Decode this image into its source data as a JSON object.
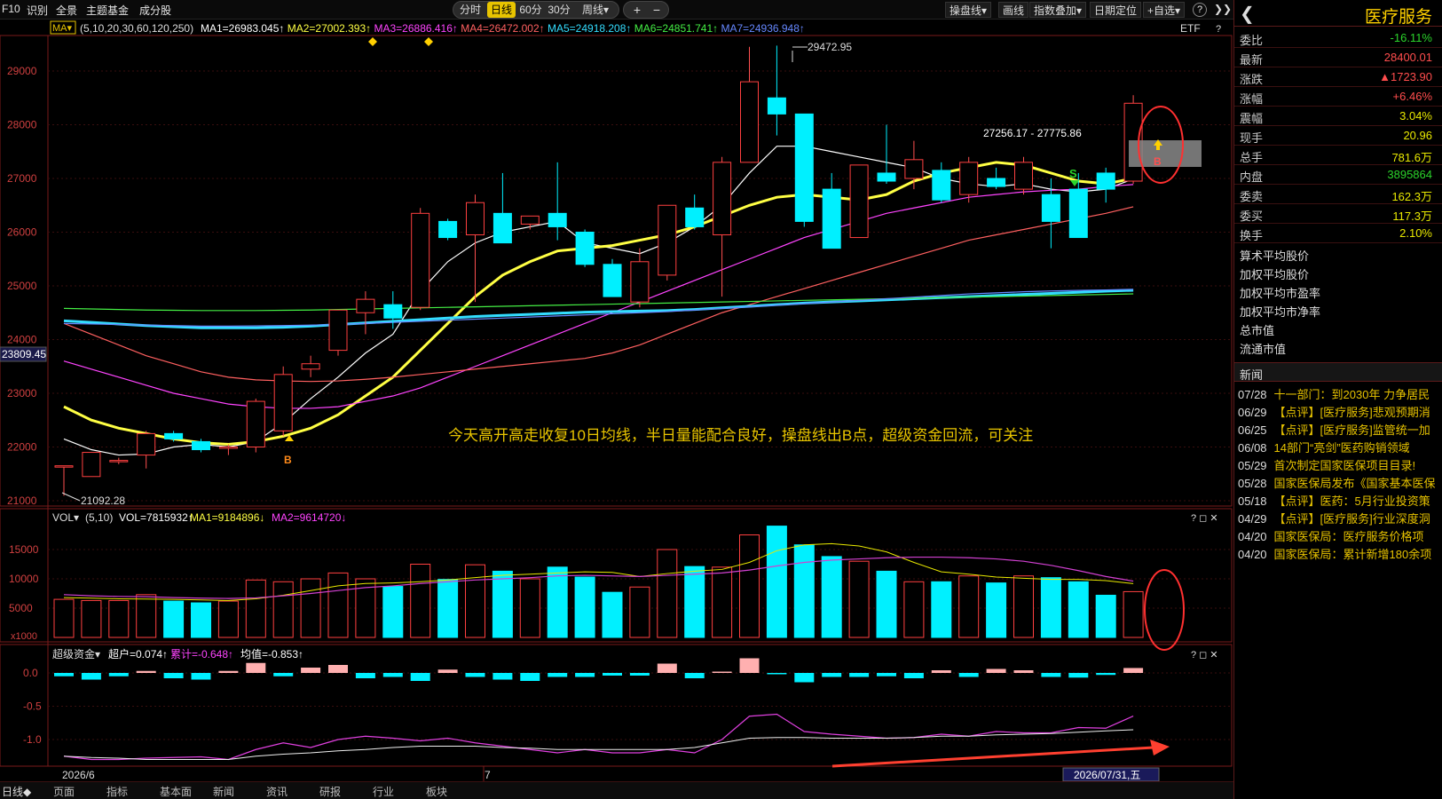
{
  "toolbar": {
    "items": [
      "F10",
      "识别",
      "全景",
      "主题基金",
      "成分股"
    ],
    "period_tabs": [
      "分时",
      "日线",
      "60分",
      "30分",
      "周线▾"
    ],
    "active_tab": "日线",
    "zoom_in": "+",
    "zoom_out": "−",
    "right_buttons": [
      "操盘线▾",
      "画线",
      "指数叠加▾",
      "日期定位",
      "+自选▾"
    ],
    "help": "?",
    "collapse": "❯❯"
  },
  "ma_line": {
    "selector": "MA▾",
    "params": "(5,10,20,30,60,120,250)",
    "entries": [
      {
        "text": "MA1=26983.045↑",
        "color": "#ffffff"
      },
      {
        "text": "MA2=27002.393↑",
        "color": "#ffff44"
      },
      {
        "text": "MA3=26886.416↑",
        "color": "#ff44ff"
      },
      {
        "text": "MA4=26472.002↑",
        "color": "#ff6060"
      },
      {
        "text": "MA5=24918.208↑",
        "color": "#33ddff"
      },
      {
        "text": "MA6=24851.741↑",
        "color": "#44ee44"
      },
      {
        "text": "MA7=24936.948↑",
        "color": "#6688ff"
      }
    ],
    "etf_label": "ETF",
    "help": "?"
  },
  "main_chart": {
    "y_ticks": [
      "29000",
      "28000",
      "27000",
      "26000",
      "25000",
      "24000",
      "23000",
      "22000",
      "21000"
    ],
    "current_label": "23809.45",
    "high_label": "29472.95",
    "low_label": "21092.28",
    "range_label": "27256.17 - 27775.86",
    "annotation": "今天高开高走收复10日均线，半日量能配合良好，操盘线出B点，超级资金回流，可关注",
    "signal_b": "B",
    "signal_s": "S"
  },
  "chart_data": {
    "type": "candlestick",
    "candles": [
      [
        21650,
        21650,
        21092,
        21650
      ],
      [
        21450,
        21900,
        21450,
        21900
      ],
      [
        21730,
        21800,
        21680,
        21750
      ],
      [
        21850,
        22300,
        21600,
        22250
      ],
      [
        22250,
        22300,
        22100,
        22150
      ],
      [
        22100,
        22150,
        21900,
        21950
      ],
      [
        22000,
        22050,
        21850,
        22000
      ],
      [
        22000,
        22900,
        21900,
        22850
      ],
      [
        22300,
        23500,
        22200,
        23350
      ],
      [
        23450,
        23700,
        23300,
        23550
      ],
      [
        23800,
        24200,
        23700,
        24550
      ],
      [
        24500,
        24900,
        24100,
        24750
      ],
      [
        24650,
        24900,
        24200,
        24400
      ],
      [
        24600,
        26450,
        24550,
        26350
      ],
      [
        26200,
        26250,
        25850,
        25900
      ],
      [
        25950,
        26700,
        24700,
        26550
      ],
      [
        26350,
        27100,
        25950,
        25800
      ],
      [
        26150,
        26300,
        26050,
        26300
      ],
      [
        26350,
        27300,
        25850,
        26100
      ],
      [
        26000,
        26050,
        25350,
        25400
      ],
      [
        25400,
        25500,
        24800,
        24800
      ],
      [
        24700,
        25700,
        24600,
        25450
      ],
      [
        25200,
        26500,
        25100,
        26500
      ],
      [
        26450,
        26700,
        26050,
        26100
      ],
      [
        25950,
        27400,
        24800,
        27300
      ],
      [
        27300,
        29450,
        27350,
        28800
      ],
      [
        28500,
        29472.95,
        27800,
        28200
      ],
      [
        28200,
        28200,
        26100,
        26200
      ],
      [
        26800,
        27100,
        25900,
        25700
      ],
      [
        25900,
        27200,
        25900,
        27250
      ],
      [
        27100,
        28000,
        26900,
        26950
      ],
      [
        27000,
        27700,
        26800,
        27350
      ],
      [
        27150,
        27300,
        26550,
        26600
      ],
      [
        26700,
        27400,
        26550,
        27300
      ],
      [
        27000,
        27200,
        26800,
        26850
      ],
      [
        26800,
        27400,
        26700,
        27300
      ],
      [
        26700,
        27000,
        25700,
        26200
      ],
      [
        26800,
        27100,
        25900,
        25900
      ],
      [
        27100,
        27200,
        26550,
        26800
      ],
      [
        26950,
        28550,
        26900,
        28400
      ]
    ],
    "ma_series": [
      {
        "name": "MA1",
        "color": "#ffffff",
        "values": [
          22150,
          21950,
          21850,
          21870,
          22000,
          22050,
          22000,
          22100,
          22450,
          22900,
          23300,
          23750,
          24100,
          24900,
          25450,
          25800,
          26000,
          26100,
          26200,
          25800,
          25700,
          25600,
          25800,
          26100,
          26500,
          27100,
          27600,
          27600,
          27500,
          27400,
          27300,
          27200,
          27000,
          26900,
          26850,
          26900,
          26800,
          26750,
          26800,
          26990
        ]
      },
      {
        "name": "MA2",
        "color": "#ffff44",
        "values": [
          22750,
          22500,
          22350,
          22250,
          22150,
          22080,
          22050,
          22100,
          22200,
          22350,
          22600,
          22950,
          23300,
          23800,
          24300,
          24800,
          25200,
          25450,
          25650,
          25700,
          25750,
          25850,
          25950,
          26100,
          26300,
          26500,
          26650,
          26700,
          26650,
          26600,
          26700,
          26950,
          27100,
          27200,
          27300,
          27250,
          27100,
          26950,
          26900,
          27002
        ]
      },
      {
        "name": "MA3",
        "color": "#ff44ff",
        "values": [
          23600,
          23450,
          23300,
          23150,
          23000,
          22900,
          22800,
          22750,
          22720,
          22720,
          22750,
          22850,
          22950,
          23100,
          23300,
          23500,
          23700,
          23900,
          24100,
          24300,
          24500,
          24700,
          24900,
          25100,
          25300,
          25500,
          25700,
          25900,
          26050,
          26200,
          26350,
          26450,
          26550,
          26650,
          26700,
          26750,
          26780,
          26800,
          26850,
          26886
        ]
      },
      {
        "name": "MA4",
        "color": "#ff6060",
        "values": [
          24300,
          24100,
          23900,
          23700,
          23550,
          23400,
          23300,
          23250,
          23230,
          23220,
          23230,
          23260,
          23300,
          23350,
          23400,
          23450,
          23500,
          23550,
          23600,
          23650,
          23750,
          23900,
          24100,
          24300,
          24500,
          24650,
          24800,
          24950,
          25100,
          25250,
          25400,
          25550,
          25700,
          25850,
          25950,
          26050,
          26150,
          26250,
          26350,
          26472
        ]
      },
      {
        "name": "MA5",
        "color": "#33ddff",
        "values": [
          24350,
          24320,
          24290,
          24260,
          24240,
          24220,
          24220,
          24220,
          24230,
          24250,
          24280,
          24310,
          24340,
          24370,
          24400,
          24430,
          24450,
          24470,
          24490,
          24510,
          24520,
          24530,
          24540,
          24560,
          24590,
          24620,
          24650,
          24680,
          24700,
          24720,
          24740,
          24760,
          24780,
          24800,
          24820,
          24840,
          24860,
          24880,
          24900,
          24918
        ]
      },
      {
        "name": "MA6",
        "color": "#44ee44",
        "values": [
          24580,
          24570,
          24560,
          24550,
          24545,
          24540,
          24540,
          24540,
          24545,
          24550,
          24560,
          24570,
          24580,
          24590,
          24600,
          24610,
          24620,
          24630,
          24640,
          24650,
          24660,
          24670,
          24680,
          24690,
          24700,
          24710,
          24720,
          24730,
          24740,
          24750,
          24760,
          24770,
          24780,
          24790,
          24800,
          24810,
          24820,
          24830,
          24840,
          24851
        ]
      },
      {
        "name": "MA7",
        "color": "#6688ff",
        "values": [
          24300,
          24290,
          24280,
          24270,
          24260,
          24250,
          24250,
          24255,
          24260,
          24270,
          24280,
          24300,
          24320,
          24340,
          24360,
          24380,
          24400,
          24420,
          24440,
          24460,
          24480,
          24500,
          24520,
          24550,
          24580,
          24610,
          24640,
          24670,
          24700,
          24730,
          24760,
          24790,
          24820,
          24850,
          24870,
          24890,
          24905,
          24915,
          24925,
          24936
        ]
      }
    ],
    "volume": [
      6500,
      6300,
      6300,
      7300,
      6200,
      5900,
      6200,
      9800,
      9500,
      10000,
      11000,
      10000,
      8700,
      12500,
      9900,
      12400,
      11300,
      10000,
      12000,
      10300,
      7700,
      8600,
      15000,
      12100,
      12000,
      17500,
      19000,
      15800,
      13800,
      13000,
      11300,
      9500,
      9500,
      10500,
      9300,
      10500,
      10200,
      9500,
      7200,
      7815
    ],
    "vol_ma1": [
      6800,
      6700,
      6600,
      6550,
      6500,
      6400,
      6300,
      6600,
      7200,
      8000,
      8800,
      9200,
      9300,
      9500,
      9800,
      10200,
      10600,
      10800,
      11000,
      11200,
      11100,
      10400,
      10900,
      11300,
      11600,
      12800,
      14800,
      15800,
      16000,
      15600,
      14600,
      12800,
      11200,
      10800,
      10300,
      10100,
      9900,
      9900,
      9700,
      9185
    ],
    "vol_ma2": [
      7300,
      7100,
      7000,
      6950,
      6800,
      6700,
      6650,
      6750,
      7100,
      7500,
      8000,
      8500,
      8800,
      9200,
      9500,
      9800,
      10000,
      10200,
      10500,
      10600,
      10500,
      10400,
      10600,
      10800,
      11000,
      11500,
      12200,
      12800,
      13200,
      13400,
      13600,
      13700,
      13700,
      13600,
      13400,
      13000,
      12300,
      11400,
      10400,
      9615
    ],
    "cap_bars": [
      -0.05,
      -0.1,
      -0.05,
      0.03,
      -0.08,
      -0.1,
      0.03,
      0.15,
      -0.05,
      0.08,
      0.12,
      -0.08,
      -0.06,
      -0.12,
      0.05,
      -0.06,
      -0.1,
      -0.12,
      -0.06,
      -0.06,
      -0.04,
      -0.04,
      0.14,
      -0.08,
      0.02,
      0.22,
      -0.02,
      -0.14,
      -0.06,
      -0.06,
      -0.05,
      -0.08,
      0.04,
      -0.06,
      0.06,
      0.04,
      -0.06,
      -0.07,
      -0.03,
      0.074
    ],
    "cap_cum": [
      -1.25,
      -1.3,
      -1.3,
      -1.28,
      -1.27,
      -1.26,
      -1.3,
      -1.15,
      -1.05,
      -1.12,
      -1.0,
      -0.95,
      -0.98,
      -1.02,
      -0.98,
      -1.05,
      -1.1,
      -1.15,
      -1.2,
      -1.15,
      -1.2,
      -1.2,
      -1.15,
      -1.2,
      -1.0,
      -0.65,
      -0.62,
      -0.88,
      -0.92,
      -0.95,
      -0.98,
      -0.97,
      -0.92,
      -0.95,
      -0.88,
      -0.9,
      -0.9,
      -0.82,
      -0.83,
      -0.648
    ],
    "cap_avg": [
      -1.25,
      -1.27,
      -1.28,
      -1.3,
      -1.3,
      -1.3,
      -1.3,
      -1.25,
      -1.22,
      -1.2,
      -1.17,
      -1.15,
      -1.12,
      -1.1,
      -1.1,
      -1.1,
      -1.12,
      -1.13,
      -1.15,
      -1.15,
      -1.15,
      -1.15,
      -1.15,
      -1.12,
      -1.05,
      -0.98,
      -0.97,
      -0.97,
      -0.98,
      -0.98,
      -0.98,
      -0.97,
      -0.95,
      -0.95,
      -0.93,
      -0.92,
      -0.91,
      -0.89,
      -0.87,
      -0.853
    ]
  },
  "vol_panel": {
    "header": "VOL▾",
    "params": "(5,10)",
    "vol": "VOL=7815932↑",
    "ma1": "MA1=9184896↓",
    "ma2": "MA2=9614720↓",
    "y_ticks": [
      "15000",
      "10000",
      "5000"
    ],
    "unit": "x1000"
  },
  "cap_panel": {
    "header": "超级资金▾",
    "chao": "超户=0.074↑",
    "leiji": "累计=-0.648↑",
    "junzhi": "均值=-0.853↑",
    "y_ticks": [
      "0.0",
      "-0.5",
      "-1.0"
    ]
  },
  "x_axis": {
    "left": "2026/6",
    "mid": "7",
    "current": "2026/07/31,五",
    "period": "日线◆"
  },
  "panel_controls": "? ◻ ✕",
  "right_panel": {
    "title": "医疗服务",
    "back": "❮",
    "quote": [
      {
        "label": "委比",
        "value": "-16.11%",
        "color": "#2bd42b"
      },
      {
        "label": "最新",
        "value": "28400.01",
        "color": "#ff4d4d"
      },
      {
        "label": "涨跌",
        "value": "▲1723.90",
        "color": "#ff4d4d"
      },
      {
        "label": "涨幅",
        "value": "+6.46%",
        "color": "#ff4d4d"
      },
      {
        "label": "震幅",
        "value": "3.04%",
        "color": "#e8e800"
      },
      {
        "label": "现手",
        "value": "20.96",
        "color": "#e8e800"
      },
      {
        "label": "总手",
        "value": "781.6万",
        "color": "#e8e800"
      },
      {
        "label": "内盘",
        "value": "3895864",
        "color": "#2bd42b"
      },
      {
        "label": "委卖",
        "value": "162.3万",
        "color": "#e8e800"
      },
      {
        "label": "委买",
        "value": "117.3万",
        "color": "#e8e800"
      },
      {
        "label": "换手",
        "value": "2.10%",
        "color": "#e8e800"
      }
    ],
    "plain": [
      "算术平均股价",
      "加权平均股价",
      "加权平均市盈率",
      "加权平均市净率",
      "总市值",
      "流通市值"
    ],
    "news_header": "新闻",
    "news": [
      {
        "date": "07/28",
        "title": "十一部门：到2030年 力争居民"
      },
      {
        "date": "06/29",
        "title": "【点评】[医疗服务]悲观预期消"
      },
      {
        "date": "06/25",
        "title": "【点评】[医疗服务]监管统一加"
      },
      {
        "date": "06/08",
        "title": "14部门“亮剑”医药购销领域"
      },
      {
        "date": "05/29",
        "title": "首次制定国家医保项目目录!"
      },
      {
        "date": "05/28",
        "title": "国家医保局发布《国家基本医保"
      },
      {
        "date": "05/18",
        "title": "【点评】医药：5月行业投资策"
      },
      {
        "date": "04/29",
        "title": "【点评】[医疗服务]行业深度洞"
      },
      {
        "date": "04/20",
        "title": "国家医保局：医疗服务价格项"
      },
      {
        "date": "04/20",
        "title": "国家医保局：累计新增180余项"
      }
    ]
  },
  "bottom_tabs": [
    "页面",
    "指标",
    "基本面",
    "新闻",
    "资讯",
    "研报",
    "行业",
    "板块"
  ]
}
